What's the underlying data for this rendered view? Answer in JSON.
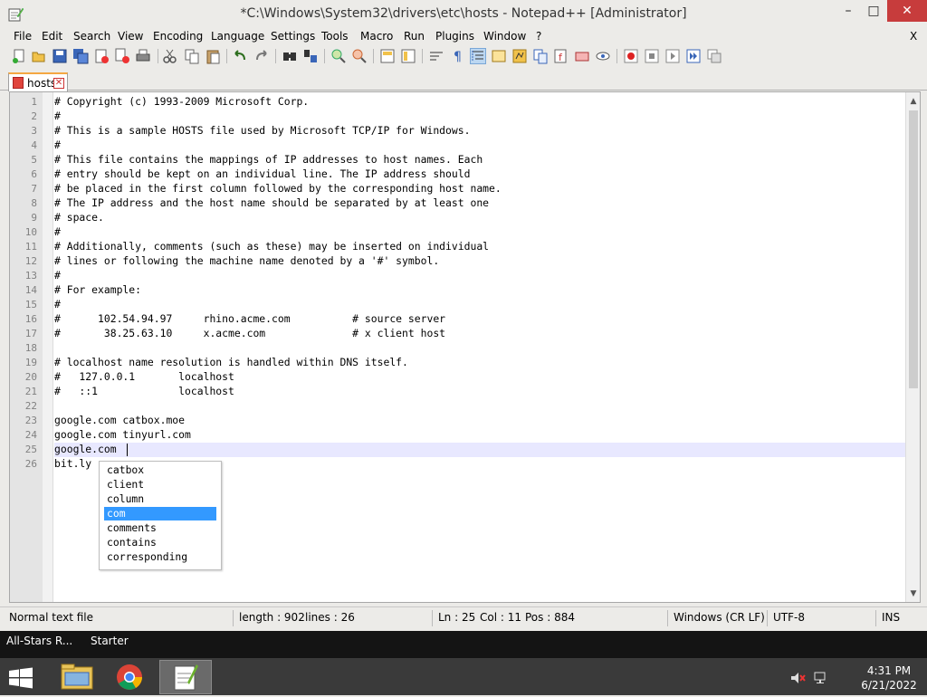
{
  "window": {
    "title": "*C:\\Windows\\System32\\drivers\\etc\\hosts - Notepad++ [Administrator]",
    "minimize": "–",
    "maximize": "□",
    "close": "✕"
  },
  "menu": {
    "items": [
      "File",
      "Edit",
      "Search",
      "View",
      "Encoding",
      "Language",
      "Settings",
      "Tools",
      "Macro",
      "Run",
      "Plugins",
      "Window",
      "?"
    ],
    "close_doc": "X"
  },
  "toolbar": {
    "icons": [
      "new-file-icon",
      "open-file-icon",
      "save-icon",
      "save-all-icon",
      "close-icon",
      "close-all-icon",
      "print-icon",
      "cut-icon",
      "copy-icon",
      "paste-icon",
      "undo-icon",
      "redo-icon",
      "find-icon",
      "replace-icon",
      "zoom-in-icon",
      "zoom-out-icon",
      "sync-vertical-icon",
      "sync-horizontal-icon",
      "word-wrap-icon",
      "show-all-chars-icon",
      "indent-guide-icon",
      "user-defined-language-icon",
      "doc-map-icon",
      "function-list-icon",
      "folder-workspace-icon",
      "monitoring-icon",
      "record-macro-icon",
      "stop-macro-icon",
      "play-macro-icon",
      "run-macro-multiple-icon",
      "save-macro-icon"
    ]
  },
  "tab": {
    "label": "hosts",
    "close": "✕"
  },
  "editor": {
    "lines": [
      "# Copyright (c) 1993-2009 Microsoft Corp.",
      "#",
      "# This is a sample HOSTS file used by Microsoft TCP/IP for Windows.",
      "#",
      "# This file contains the mappings of IP addresses to host names. Each",
      "# entry should be kept on an individual line. The IP address should",
      "# be placed in the first column followed by the corresponding host name.",
      "# The IP address and the host name should be separated by at least one",
      "# space.",
      "#",
      "# Additionally, comments (such as these) may be inserted on individual",
      "# lines or following the machine name denoted by a '#' symbol.",
      "#",
      "# For example:",
      "#",
      "#      102.54.94.97     rhino.acme.com          # source server",
      "#       38.25.63.10     x.acme.com              # x client host",
      "",
      "# localhost name resolution is handled within DNS itself.",
      "#   127.0.0.1       localhost",
      "#   ::1             localhost",
      "",
      "google.com catbox.moe",
      "google.com tinyurl.com",
      "google.com",
      "bit.ly"
    ],
    "line_numbers": [
      "1",
      "2",
      "3",
      "4",
      "5",
      "6",
      "7",
      "8",
      "9",
      "10",
      "11",
      "12",
      "13",
      "14",
      "15",
      "16",
      "17",
      "18",
      "19",
      "20",
      "21",
      "22",
      "23",
      "24",
      "25",
      "26"
    ]
  },
  "autocomplete": {
    "items": [
      "catbox",
      "client",
      "column",
      "com",
      "comments",
      "contains",
      "corresponding"
    ],
    "selected": "com"
  },
  "scrollbar": {
    "up": "▲",
    "down": "▼"
  },
  "status": {
    "file_type": "Normal text file",
    "length": "length : 902",
    "lines": "lines : 26",
    "ln": "Ln : 25",
    "col": "Col : 11",
    "pos": "Pos : 884",
    "eol": "Windows (CR LF)",
    "encoding": "UTF-8",
    "mode": "INS"
  },
  "taskbar_top": {
    "left_text": "All-Stars R...",
    "right_text": "Starter"
  },
  "taskbar": {
    "apps": [
      "file-explorer-icon",
      "chrome-icon",
      "notepad-plus-plus-icon"
    ],
    "time": "4:31 PM",
    "date": "6/21/2022"
  }
}
